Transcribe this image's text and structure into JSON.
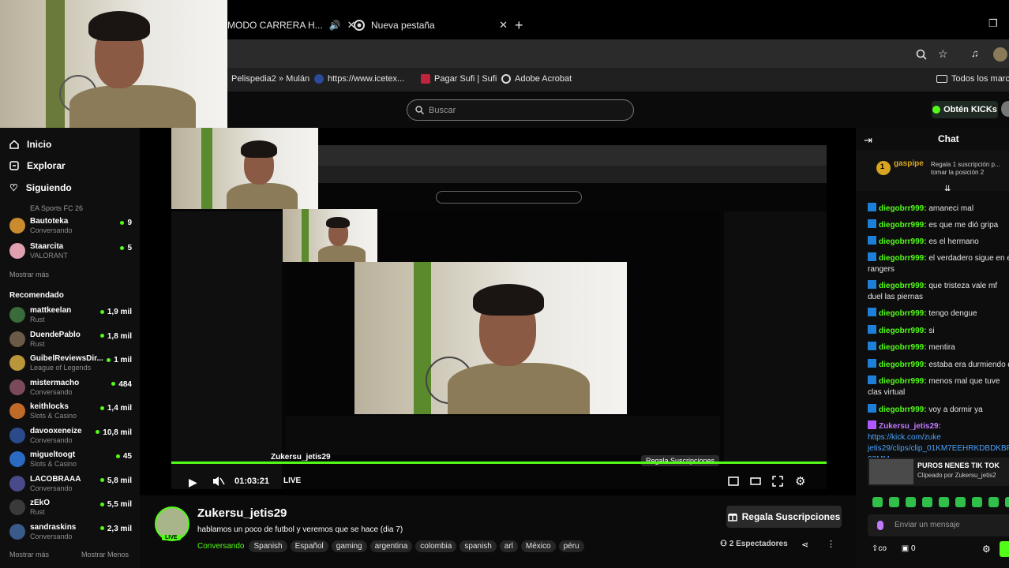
{
  "browser": {
    "tabs": [
      {
        "label": "MODO CARRERA H...",
        "speaker": true
      },
      {
        "label": "Nueva pestaña"
      }
    ],
    "new_tab": "+",
    "bookmarks": [
      "Pelispedia2 » Mulán",
      "https://www.icetex...",
      "Pagar Sufi | Sufi",
      "Adobe Acrobat",
      "Todos los marc..."
    ]
  },
  "kick": {
    "search_placeholder": "Buscar",
    "get_kicks": "Obtén KICKs"
  },
  "sidebar": {
    "nav": [
      {
        "label": "Inicio",
        "icon": "home-icon"
      },
      {
        "label": "Explorar",
        "icon": "compass-icon"
      },
      {
        "label": "Siguiendo",
        "icon": "heart-icon"
      }
    ],
    "following_top_game": "EA Sports FC 26",
    "following": [
      {
        "name": "Bautoteka",
        "game": "Conversando",
        "viewers": "9",
        "color": "#c98b2d"
      },
      {
        "name": "Staarcita",
        "game": "VALORANT",
        "viewers": "5",
        "color": "#e0a0b0"
      }
    ],
    "show_more": "Mostrar más",
    "recommended_title": "Recomendado",
    "recommended": [
      {
        "name": "mattkeelan",
        "game": "Rust",
        "viewers": "1,9 mil",
        "color": "#3a6b3a"
      },
      {
        "name": "DuendePablo",
        "game": "Rust",
        "viewers": "1,8 mil",
        "color": "#6b5a48"
      },
      {
        "name": "GuibelReviewsDir...",
        "game": "League of Legends",
        "viewers": "1 mil",
        "color": "#b8963a"
      },
      {
        "name": "mistermacho",
        "game": "Conversando",
        "viewers": "484",
        "color": "#7a4a5a"
      },
      {
        "name": "keithlocks",
        "game": "Slots & Casino",
        "viewers": "1,4 mil",
        "color": "#c06a2a"
      },
      {
        "name": "davooxeneize",
        "game": "Conversando",
        "viewers": "10,8 mil",
        "color": "#2a4a8a"
      },
      {
        "name": "migueltoogt",
        "game": "Slots & Casino",
        "viewers": "45",
        "color": "#2a6ac0"
      },
      {
        "name": "LACOBRAAA",
        "game": "Conversando",
        "viewers": "5,8 mil",
        "color": "#4a4a8a"
      },
      {
        "name": "zEkO",
        "game": "Rust",
        "viewers": "5,5 mil",
        "color": "#3a3a3a"
      },
      {
        "name": "sandraskins",
        "game": "Conversando",
        "viewers": "2,3 mil",
        "color": "#3a5a8a"
      }
    ],
    "show_more2": "Mostrar más",
    "show_less": "Mostrar Menos"
  },
  "player": {
    "time": "01:03:21",
    "live": "LIVE"
  },
  "stream": {
    "channel": "Zukersu_jetis29",
    "title": "hablamos un poco de futbol y veremos que se hace (dia 7)",
    "category": "Conversando",
    "tags": [
      "Spanish",
      "Español",
      "gaming",
      "argentina",
      "colombia",
      "spanish",
      "arl",
      "México",
      "péru"
    ],
    "gift_button": "Regala Suscripciones",
    "viewers": "2 Espectadores",
    "live_badge": "LIVE"
  },
  "chat": {
    "title": "Chat",
    "pinned_user": "gaspipe",
    "pinned_count": "1",
    "pinned_text": "Regala 1 suscripción p... tomar la posición 2",
    "messages": [
      {
        "user": "diegobrr999:",
        "text": "amaneci mal"
      },
      {
        "user": "diegobrr999:",
        "text": "es que me dió gripa"
      },
      {
        "user": "diegobrr999:",
        "text": "es el hermano"
      },
      {
        "user": "diegobrr999:",
        "text": "el verdadero sigue en el rangers"
      },
      {
        "user": "diegobrr999:",
        "text": "que tristeza vale mf duel las piernas"
      },
      {
        "user": "diegobrr999:",
        "text": "tengo dengue"
      },
      {
        "user": "diegobrr999:",
        "text": "si"
      },
      {
        "user": "diegobrr999:",
        "text": "mentira"
      },
      {
        "user": "diegobrr999:",
        "text": "estaba era durmiendo d"
      },
      {
        "user": "diegobrr999:",
        "text": "menos mal que tuve clas virtual"
      },
      {
        "user": "diegobrr999:",
        "text": "voy a dormir ya"
      }
    ],
    "clip_msg_user": "Zukersu_jetis29:",
    "clip_msg_text": "https://kick.com/zuke jetis29/clips/clip_01KM7EEHRKDBDKBP20 93MM",
    "clip_title": "PUROS NENES TIK TOK",
    "clip_by": "Clipeado por Zukersu_jetis2",
    "send_placeholder": "Enviar un mensaje",
    "footer_count": "0",
    "footer_points": "co"
  },
  "colors": {
    "accent": "#53fc18",
    "bg": "#0b0b0b"
  }
}
